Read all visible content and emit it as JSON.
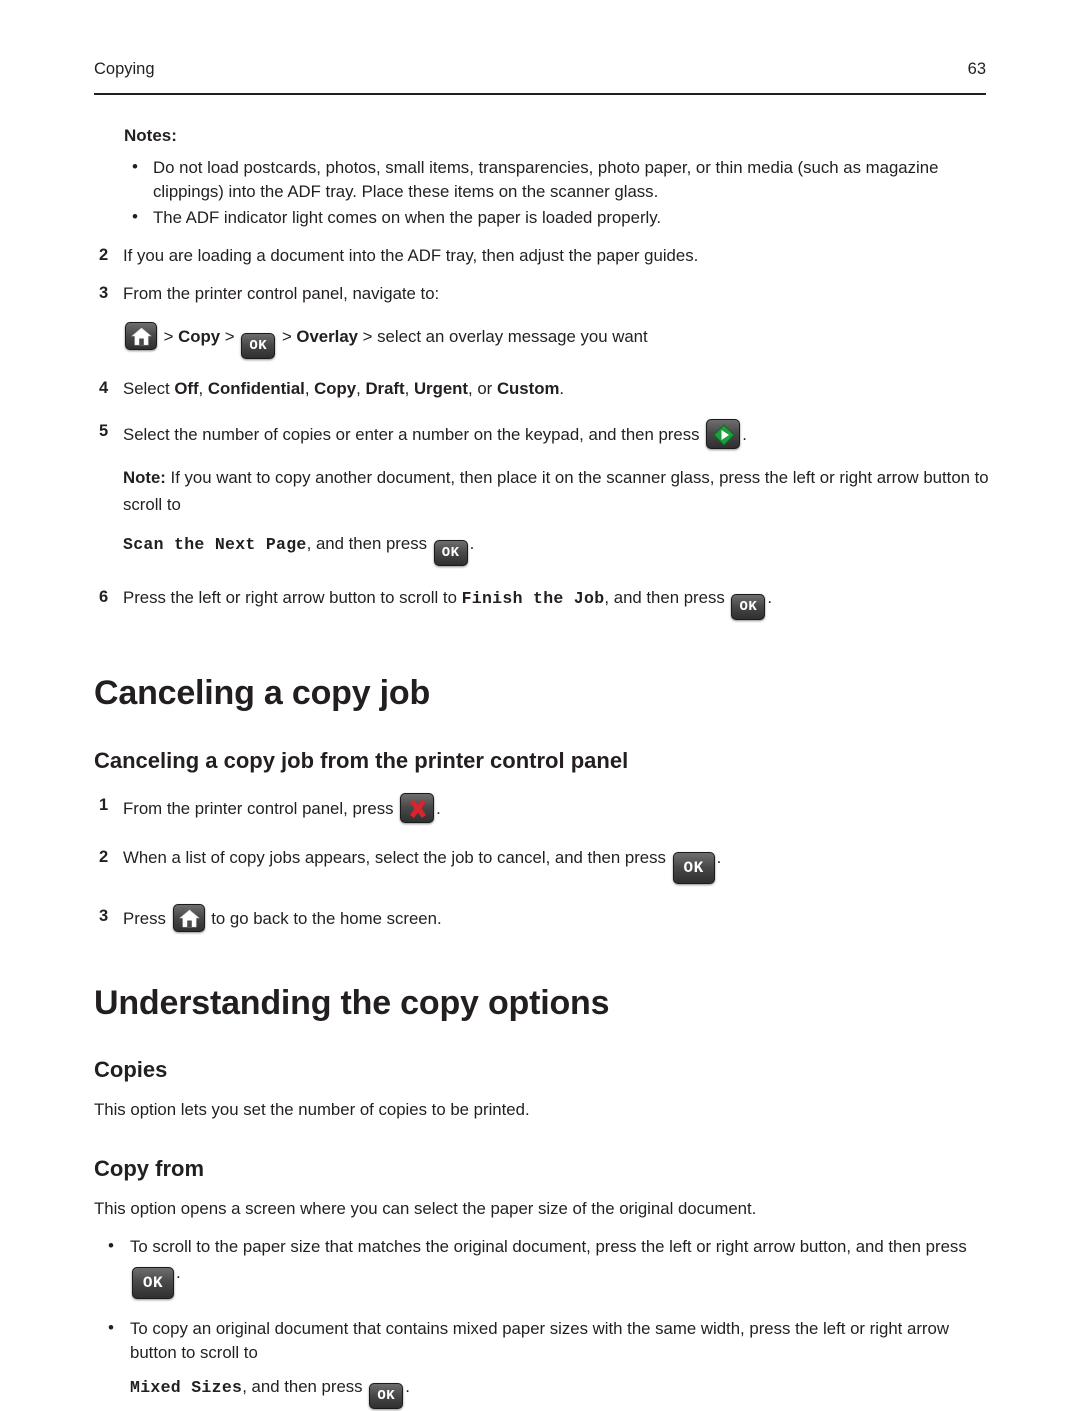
{
  "header": {
    "chapter": "Copying",
    "page_number": "63"
  },
  "notes": {
    "label": "Notes:",
    "items": [
      "Do not load postcards, photos, small items, transparencies, photo paper, or thin media (such as magazine clippings) into the ADF tray. Place these items on the scanner glass.",
      "The ADF indicator light comes on when the paper is loaded properly."
    ]
  },
  "steps_top": [
    {
      "num": "2",
      "text": "If you are loading a document into the ADF tray, then adjust the paper guides."
    },
    {
      "num": "3",
      "text": "From the printer control panel, navigate to:"
    }
  ],
  "navigate_path": {
    "home_icon": "home-icon",
    "sep1": ">",
    "copy_label": "Copy",
    "sep2": ">",
    "ok_icon": "OK",
    "sep3": ">",
    "overlay_label": "Overlay",
    "sep4": ">",
    "tail": "select an overlay message you want"
  },
  "step4": {
    "num": "4",
    "prefix": "Select ",
    "options": [
      "Off",
      "Confidential",
      "Copy",
      "Draft",
      "Urgent"
    ],
    "last_option": "Custom",
    "suffix": "."
  },
  "step5": {
    "num": "5",
    "text": "Select the number of copies or enter a number on the keypad, and then press",
    "start_icon": "start-icon",
    "period": "."
  },
  "note5": {
    "label": "Note:",
    "text": " If you want to copy another document, then place it on the scanner glass, press the left or right arrow button to scroll to ",
    "mono": "Scan the Next Page",
    "text2": ", and then press ",
    "ok_icon": "OK",
    "period": "."
  },
  "step6": {
    "num": "6",
    "text": "Press the left or right arrow button to scroll to ",
    "mono": "Finish the Job",
    "text2": ", and then press ",
    "ok_icon": "OK",
    "period": "."
  },
  "section_cancel": {
    "title": "Canceling a copy job",
    "subtitle": "Canceling a copy job from the printer control panel",
    "steps": [
      {
        "num": "1",
        "before": "From the printer control panel, press ",
        "icon": "stop-icon",
        "after": "."
      },
      {
        "num": "2",
        "before": "When a list of copy jobs appears, select the job to cancel, and then press ",
        "icon": "OK",
        "after": "."
      },
      {
        "num": "3",
        "before": "Press ",
        "icon": "home-icon",
        "after": " to go back to the home screen."
      }
    ]
  },
  "section_options": {
    "title": "Understanding the copy options",
    "copies": {
      "heading": "Copies",
      "body": "This option lets you set the number of copies to be printed."
    },
    "copy_from": {
      "heading": "Copy from",
      "body": "This option opens a screen where you can select the paper size of the original document.",
      "bullets": [
        {
          "before": "To scroll to the paper size that matches the original document, press the left or right arrow button, and then press ",
          "icon": "OK",
          "after": "."
        },
        {
          "before": "To copy an original document that contains mixed paper sizes with the same width, press the left or right arrow button to scroll to ",
          "mono": "Mixed Sizes",
          "middle": ", and then press ",
          "icon": "OK",
          "after": "."
        }
      ]
    }
  }
}
